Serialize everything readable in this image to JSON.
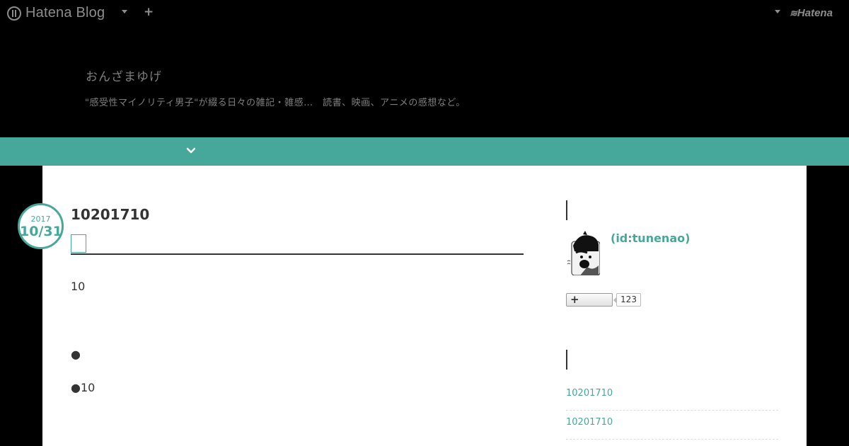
{
  "globalbar": {
    "brand": "Hatena Blog",
    "plus_label": "+",
    "hatena_label": "Hatena"
  },
  "header": {
    "title": "おんざまゆげ",
    "description": "\"感受性マイノリティ男子\"が綴る日々の雑記・雑感…　読書、映画、アニメの感想など。"
  },
  "entry": {
    "date": {
      "year": "2017",
      "month_day": "10/31"
    },
    "title": "10201710",
    "paragraphs": [
      "10",
      "●",
      "●10"
    ]
  },
  "sidebar": {
    "profile": {
      "id_label": "(id:tunenao)"
    },
    "follow": {
      "plus_label": "+",
      "count": "123"
    },
    "recent_entries": [
      "10201710",
      "10201710"
    ]
  },
  "colors": {
    "accent": "#46a89b",
    "background": "#000000",
    "content_bg": "#ffffff",
    "text": "#333333",
    "header_text": "#7f7f7f"
  },
  "icons": [
    "hatena-blog-logo-icon",
    "caret-down-icon",
    "plus-icon",
    "chevron-down-icon",
    "hatena-logo-icon",
    "avatar-image"
  ]
}
